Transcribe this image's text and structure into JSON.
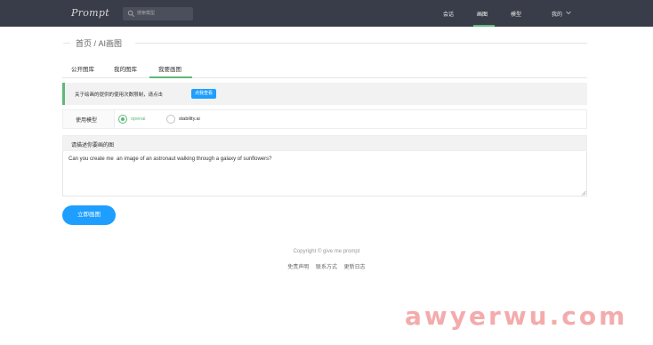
{
  "header": {
    "logo": "Prompt",
    "search_placeholder": "搜索模型",
    "nav": [
      "会话",
      "画图",
      "模型",
      "我的"
    ],
    "active_nav": "画图"
  },
  "breadcrumb": "首页 / AI画图",
  "tabs": [
    "公开图库",
    "我的图库",
    "我要画图"
  ],
  "active_tab": "我要画图",
  "notice": {
    "text": "关于绘画的提供的使用次数限制，请点击",
    "button": "点我查看"
  },
  "model": {
    "label": "使用模型",
    "options": [
      "openai",
      "stability.ai"
    ],
    "selected": "openai"
  },
  "prompt": {
    "label": "请描述你要画的图",
    "value": "Can you create me  an image of an astronaut walking through a galaxy of sunflowers?"
  },
  "submit_label": "立即画图",
  "footer": {
    "copyright": "Copyright ©  give me prompt",
    "links": [
      "免责声明",
      "联系方式",
      "更新日志"
    ]
  },
  "watermark": "awyerwu.com",
  "colors": {
    "topbar": "#393d49",
    "accent_green": "#5fb878",
    "accent_blue": "#1e9fff"
  }
}
